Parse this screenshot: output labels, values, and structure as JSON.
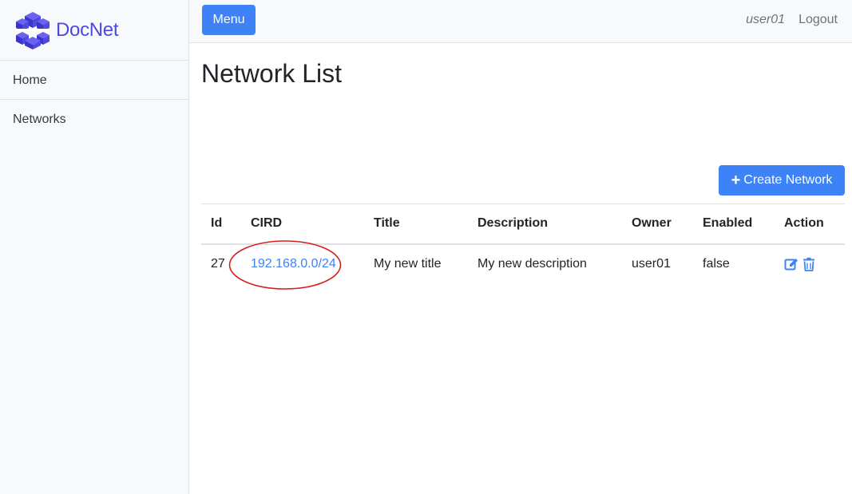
{
  "sidebar": {
    "brand": "DocNet",
    "items": [
      {
        "label": "Home"
      },
      {
        "label": "Networks"
      }
    ]
  },
  "topbar": {
    "menu_label": "Menu",
    "user": "user01",
    "logout_label": "Logout"
  },
  "main": {
    "title": "Network List",
    "create_label": "Create Network",
    "table": {
      "headers": [
        "Id",
        "CIRD",
        "Title",
        "Description",
        "Owner",
        "Enabled",
        "Action"
      ],
      "rows": [
        {
          "id": "27",
          "cird": "192.168.0.0/24",
          "title": "My new title",
          "description": "My new description",
          "owner": "user01",
          "enabled": "false"
        }
      ]
    }
  },
  "colors": {
    "accent": "#3d82f6",
    "brand": "#4a4ae0",
    "highlight": "#d62020"
  },
  "icons": {
    "logo": "stacked-cubes-logo",
    "create": "plus-icon",
    "edit": "edit-icon",
    "delete": "trash-icon"
  }
}
